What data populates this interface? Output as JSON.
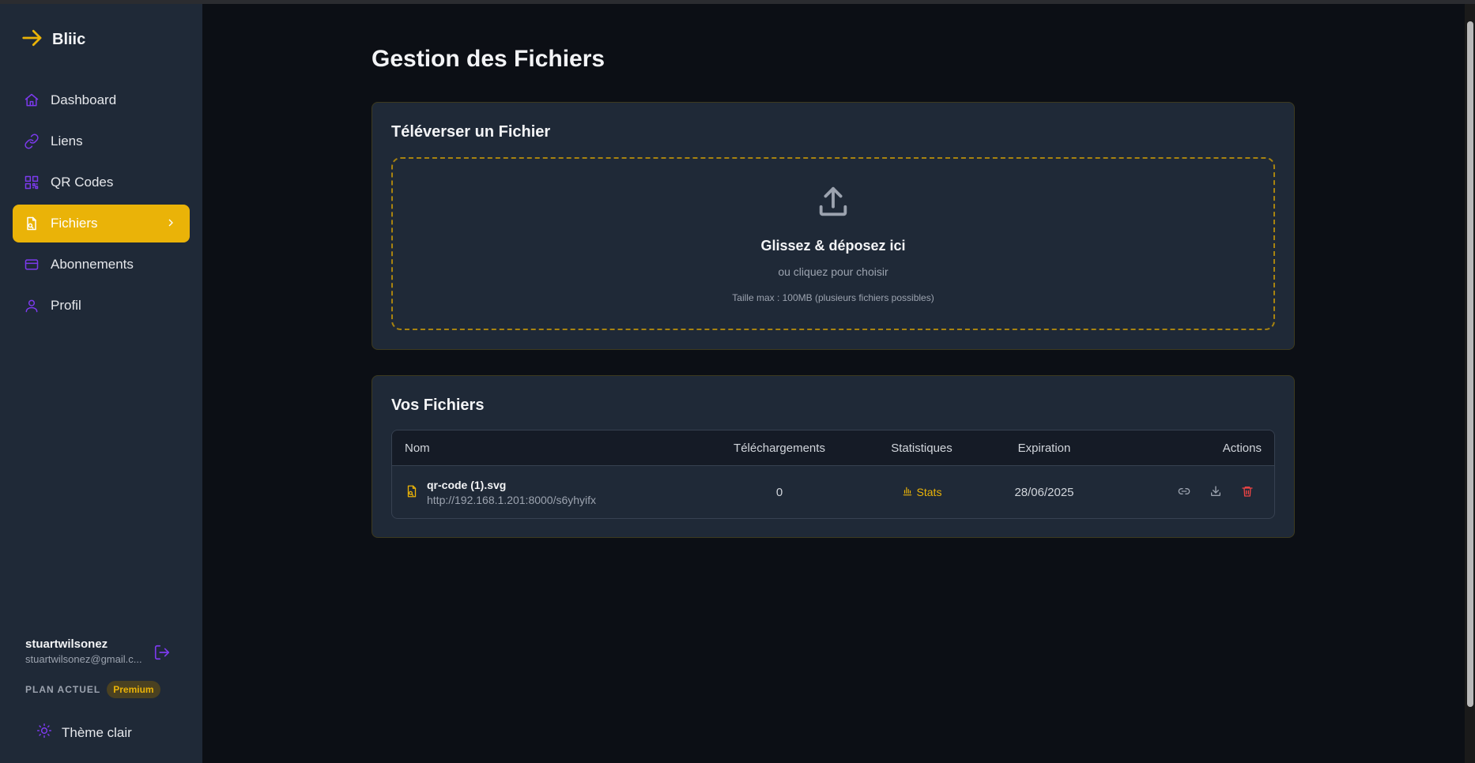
{
  "brand": {
    "name": "Bliic",
    "accent": "#eab308"
  },
  "sidebar": {
    "items": [
      {
        "label": "Dashboard",
        "icon": "home-icon"
      },
      {
        "label": "Liens",
        "icon": "link-icon"
      },
      {
        "label": "QR Codes",
        "icon": "qr-code-icon"
      },
      {
        "label": "Fichiers",
        "icon": "file-icon",
        "active": true
      },
      {
        "label": "Abonnements",
        "icon": "credit-card-icon"
      },
      {
        "label": "Profil",
        "icon": "user-icon"
      }
    ],
    "user": {
      "name": "stuartwilsonez",
      "email": "stuartwilsonez@gmail.c..."
    },
    "plan_label": "PLAN ACTUEL",
    "plan_badge": "Premium",
    "theme_toggle": "Thème clair"
  },
  "main": {
    "title": "Gestion des Fichiers",
    "upload": {
      "title": "Téléverser un Fichier",
      "drop_main": "Glissez & déposez ici",
      "drop_sub": "ou cliquez pour choisir",
      "drop_hint": "Taille max : 100MB (plusieurs fichiers possibles)"
    },
    "files": {
      "title": "Vos Fichiers",
      "columns": [
        "Nom",
        "Téléchargements",
        "Statistiques",
        "Expiration",
        "Actions"
      ],
      "rows": [
        {
          "name": "qr-code (1).svg",
          "url": "http://192.168.1.201:8000/s6yhyifx",
          "downloads": "0",
          "stats": "Stats",
          "expiration": "28/06/2025"
        }
      ]
    }
  }
}
